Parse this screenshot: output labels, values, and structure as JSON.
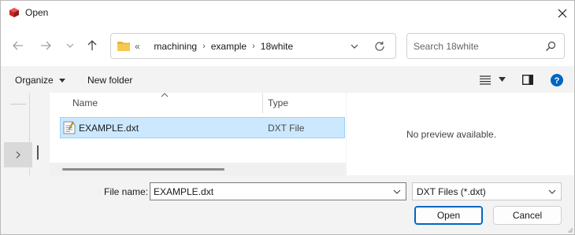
{
  "window": {
    "title": "Open",
    "app_icon": "cube-app-icon"
  },
  "navigation": {
    "back_icon": "arrow-left-icon",
    "forward_icon": "arrow-right-icon",
    "recent_icon": "chevron-down-icon",
    "up_icon": "arrow-up-icon"
  },
  "address": {
    "overflow": "«",
    "crumbs": [
      "machining",
      "example",
      "18white"
    ],
    "separator": "›"
  },
  "search": {
    "placeholder": "Search 18white"
  },
  "commandbar": {
    "organize_label": "Organize",
    "new_folder_label": "New folder"
  },
  "file_list": {
    "columns": {
      "name": "Name",
      "type": "Type"
    },
    "files": [
      {
        "name": "EXAMPLE.dxt",
        "type": "DXT File",
        "selected": true
      }
    ]
  },
  "preview": {
    "message": "No preview available."
  },
  "footer": {
    "file_name_label": "File name:",
    "file_name_value": "EXAMPLE.dxt",
    "filter_value": "DXT Files (*.dxt)",
    "open_label": "Open",
    "cancel_label": "Cancel"
  },
  "colors": {
    "accent": "#0067c0",
    "selection": "#cce8ff",
    "help": "#0067c0",
    "folder": "#f0c14b"
  }
}
